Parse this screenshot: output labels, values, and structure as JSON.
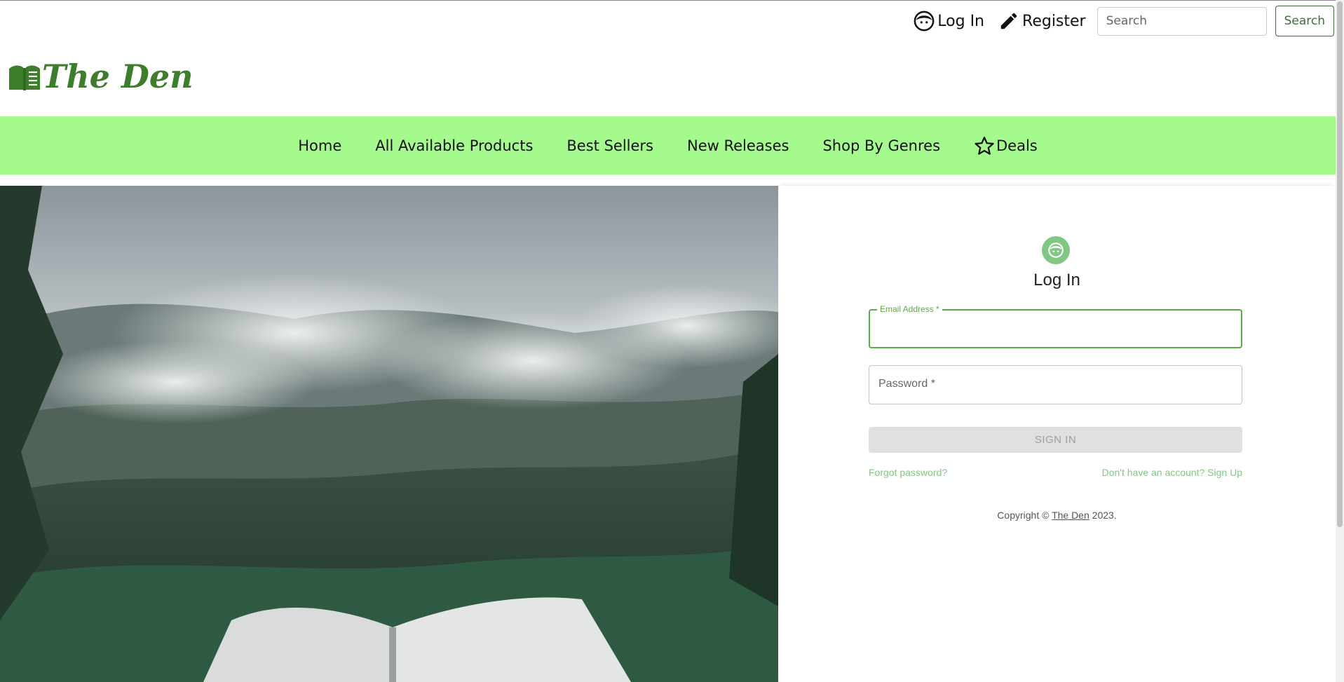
{
  "header": {
    "login_label": "Log In",
    "register_label": "Register",
    "search_placeholder": "Search",
    "search_button": "Search"
  },
  "brand": {
    "name": "The Den",
    "color": "#3d7d2c"
  },
  "nav": {
    "background": "#a4fa8d",
    "items": [
      {
        "label": "Home"
      },
      {
        "label": "All Available Products"
      },
      {
        "label": "Best Sellers"
      },
      {
        "label": "New Releases"
      },
      {
        "label": "Shop By Genres"
      },
      {
        "label": "Deals",
        "icon": "star-icon"
      }
    ]
  },
  "login": {
    "title": "Log In",
    "email_label": "Email Address *",
    "password_label": "Password *",
    "signin_button": "SIGN IN",
    "forgot_link": "Forgot password?",
    "signup_link": "Don't have an account? Sign Up",
    "copyright_prefix": "Copyright © ",
    "copyright_link": "The Den",
    "copyright_suffix": " 2023.",
    "accent": "#81c784"
  }
}
